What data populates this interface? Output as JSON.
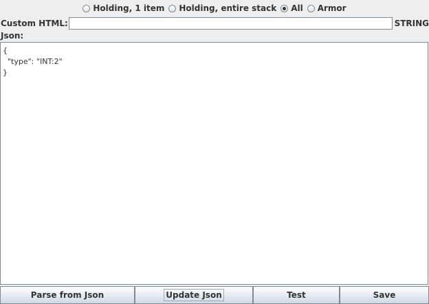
{
  "radio_options": [
    {
      "label": "Holding, 1 item",
      "checked": false
    },
    {
      "label": "Holding, entire stack",
      "checked": false
    },
    {
      "label": "All",
      "checked": true
    },
    {
      "label": "Armor",
      "checked": false
    }
  ],
  "custom_html": {
    "label": "Custom HTML:",
    "value": "",
    "type_label": "STRING"
  },
  "json": {
    "label": "Json:",
    "content": "{\n  \"type\": \"INT:2\"\n}"
  },
  "buttons": {
    "parse": "Parse from Json",
    "update": "Update Json",
    "test": "Test",
    "save": "Save"
  },
  "colors": {
    "background": "#eeeeee",
    "border": "#7a8a99",
    "text": "#333333"
  }
}
